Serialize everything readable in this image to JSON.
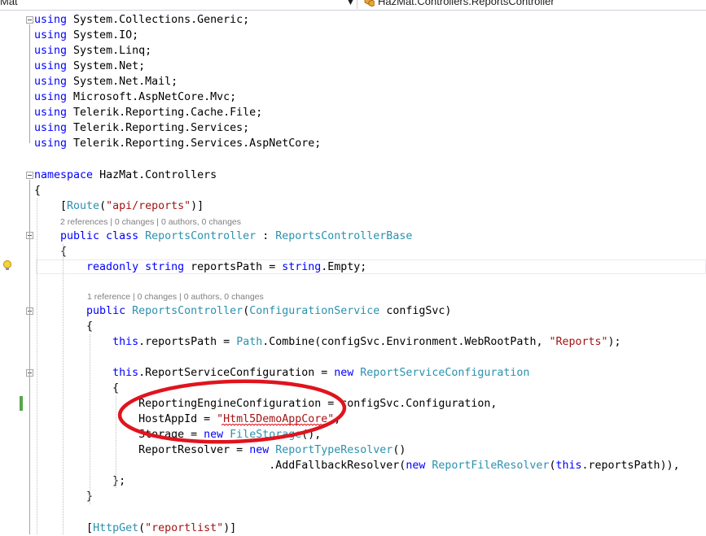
{
  "navbar": {
    "project_dropdown": "Mat",
    "type_dropdown": "HazMat.Controllers.ReportsController"
  },
  "code_lines": [
    [
      [
        "kw",
        "using"
      ],
      [
        "pl",
        " System.Collections.Generic;"
      ]
    ],
    [
      [
        "kw",
        "using"
      ],
      [
        "pl",
        " System.IO;"
      ]
    ],
    [
      [
        "kw",
        "using"
      ],
      [
        "pl",
        " System.Linq;"
      ]
    ],
    [
      [
        "kw",
        "using"
      ],
      [
        "pl",
        " System.Net;"
      ]
    ],
    [
      [
        "kw",
        "using"
      ],
      [
        "pl",
        " System.Net.Mail;"
      ]
    ],
    [
      [
        "kw",
        "using"
      ],
      [
        "pl",
        " Microsoft.AspNetCore.Mvc;"
      ]
    ],
    [
      [
        "kw",
        "using"
      ],
      [
        "pl",
        " Telerik.Reporting.Cache.File;"
      ]
    ],
    [
      [
        "kw",
        "using"
      ],
      [
        "pl",
        " Telerik.Reporting.Services;"
      ]
    ],
    [
      [
        "kw",
        "using"
      ],
      [
        "pl",
        " Telerik.Reporting.Services.AspNetCore;"
      ]
    ],
    [
      [
        "kw",
        "namespace"
      ],
      [
        "pl",
        " HazMat.Controllers"
      ]
    ],
    [
      [
        "pl",
        "{"
      ]
    ],
    [
      [
        "pl",
        "    ["
      ],
      [
        "ty",
        "Route"
      ],
      [
        "pl",
        "("
      ],
      [
        "str",
        "\"api/reports\""
      ],
      [
        "pl",
        ")]"
      ]
    ],
    [
      [
        "kw",
        "    public class "
      ],
      [
        "ty",
        "ReportsController"
      ],
      [
        "pl",
        " : "
      ],
      [
        "ty",
        "ReportsControllerBase"
      ]
    ],
    [
      [
        "pl",
        "    {"
      ]
    ],
    [
      [
        "kw",
        "        readonly string"
      ],
      [
        "pl",
        " reportsPath = "
      ],
      [
        "kw",
        "string"
      ],
      [
        "pl",
        ".Empty;"
      ]
    ],
    [
      [
        "kw",
        "        public "
      ],
      [
        "ty",
        "ReportsController"
      ],
      [
        "pl",
        "("
      ],
      [
        "ty",
        "ConfigurationService"
      ],
      [
        "pl",
        " configSvc)"
      ]
    ],
    [
      [
        "pl",
        "        {"
      ]
    ],
    [
      [
        "kw",
        "            this"
      ],
      [
        "pl",
        ".reportsPath = "
      ],
      [
        "ty",
        "Path"
      ],
      [
        "pl",
        ".Combine(configSvc.Environment.WebRootPath, "
      ],
      [
        "str",
        "\"Reports\""
      ],
      [
        "pl",
        ");"
      ]
    ],
    [
      [
        "kw",
        "            this"
      ],
      [
        "pl",
        ".ReportServiceConfiguration = "
      ],
      [
        "kw",
        "new "
      ],
      [
        "ty",
        "ReportServiceConfiguration"
      ]
    ],
    [
      [
        "pl",
        "            {"
      ]
    ],
    [
      [
        "pl",
        "                ReportingEngineConfiguration = configSvc.Configuration,"
      ]
    ],
    [
      [
        "pl",
        "                HostAppId = "
      ],
      [
        "str",
        "\"Html5DemoAppCore\""
      ],
      [
        "pl",
        ","
      ]
    ],
    [
      [
        "pl",
        "                Storage = "
      ],
      [
        "kw",
        "new "
      ],
      [
        "ty",
        "FileStorage"
      ],
      [
        "pl",
        "(),"
      ]
    ],
    [
      [
        "pl",
        "                ReportResolver = "
      ],
      [
        "kw",
        "new "
      ],
      [
        "ty",
        "ReportTypeResolver"
      ],
      [
        "pl",
        "()"
      ]
    ],
    [
      [
        "pl",
        "                                    .AddFallbackResolver("
      ],
      [
        "kw",
        "new "
      ],
      [
        "ty",
        "ReportFileResolver"
      ],
      [
        "pl",
        "("
      ],
      [
        "kw",
        "this"
      ],
      [
        "pl",
        ".reportsPath)),"
      ]
    ],
    [
      [
        "pl",
        "            };"
      ]
    ],
    [
      [
        "pl",
        "        }"
      ]
    ],
    [
      [
        "pl",
        "        ["
      ],
      [
        "ty",
        "HttpGet"
      ],
      [
        "pl",
        "("
      ],
      [
        "str",
        "\"reportlist\""
      ],
      [
        "pl",
        ")]"
      ]
    ]
  ],
  "codelens": [
    "2 references | 0 changes | 0 authors, 0 changes",
    "1 reference | 0 changes | 0 authors, 0 changes"
  ],
  "colors": {
    "keyword": "#0000ff",
    "type": "#2b91af",
    "string": "#a31515",
    "annotation": "#e0141e",
    "change_marker": "#57a64a"
  }
}
